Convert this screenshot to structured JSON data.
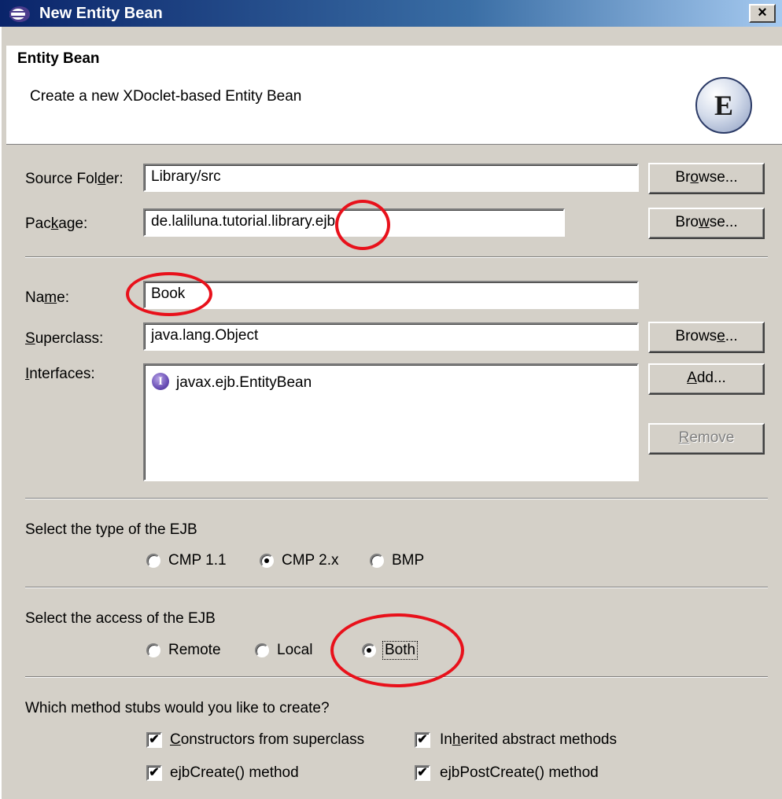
{
  "window": {
    "title": "New Entity Bean",
    "close_glyph": "×",
    "icon": "eclipse-icon"
  },
  "header": {
    "title": "Entity Bean",
    "description": "Create a new XDoclet-based Entity Bean",
    "badge_letter": "E"
  },
  "source_folder": {
    "label_pre": "Source Fol",
    "label_mn": "d",
    "label_post": "er:",
    "value": "Library/src",
    "browse_pre": "Br",
    "browse_mn": "o",
    "browse_post": "wse..."
  },
  "package": {
    "label_pre": "Pac",
    "label_mn": "k",
    "label_post": "age:",
    "value": "de.laliluna.tutorial.library.ejb",
    "browse_pre": "Bro",
    "browse_mn": "w",
    "browse_post": "se..."
  },
  "name": {
    "label_pre": "Na",
    "label_mn": "m",
    "label_post": "e:",
    "value": "Book"
  },
  "superclass": {
    "label_mn": "S",
    "label_post": "uperclass:",
    "value": "java.lang.Object",
    "browse_pre": "Brows",
    "browse_mn": "e",
    "browse_post": "..."
  },
  "interfaces": {
    "label_mn": "I",
    "label_post": "nterfaces:",
    "items": [
      {
        "icon": "interface-icon",
        "icon_glyph": "I",
        "label": "javax.ejb.EntityBean"
      }
    ],
    "add_mn": "A",
    "add_post": "dd...",
    "remove_mn": "R",
    "remove_post": "emove"
  },
  "ejb_type": {
    "label": "Select the type of the EJB",
    "options": [
      "CMP 1.1",
      "CMP 2.x",
      "BMP"
    ],
    "selected": "CMP 2.x"
  },
  "ejb_access": {
    "label": "Select the access of the EJB",
    "options": [
      "Remote",
      "Local",
      "Both"
    ],
    "selected": "Both"
  },
  "method_stubs": {
    "label": "Which method stubs would you like to create?",
    "constructors_mn": "C",
    "constructors_post": "onstructors from superclass",
    "inherited_pre": "In",
    "inherited_mn": "h",
    "inherited_post": "erited abstract methods",
    "ejb_create": "ejbCreate() method",
    "ejb_post_create": "ejbPostCreate() method",
    "check_glyph": "✔",
    "checked": [
      true,
      true,
      true,
      true
    ]
  },
  "colors": {
    "annotation": "#e8111b",
    "dialog_bg": "#d4d0c8",
    "titlebar_start": "#0a246a",
    "titlebar_end": "#a6caf0"
  }
}
